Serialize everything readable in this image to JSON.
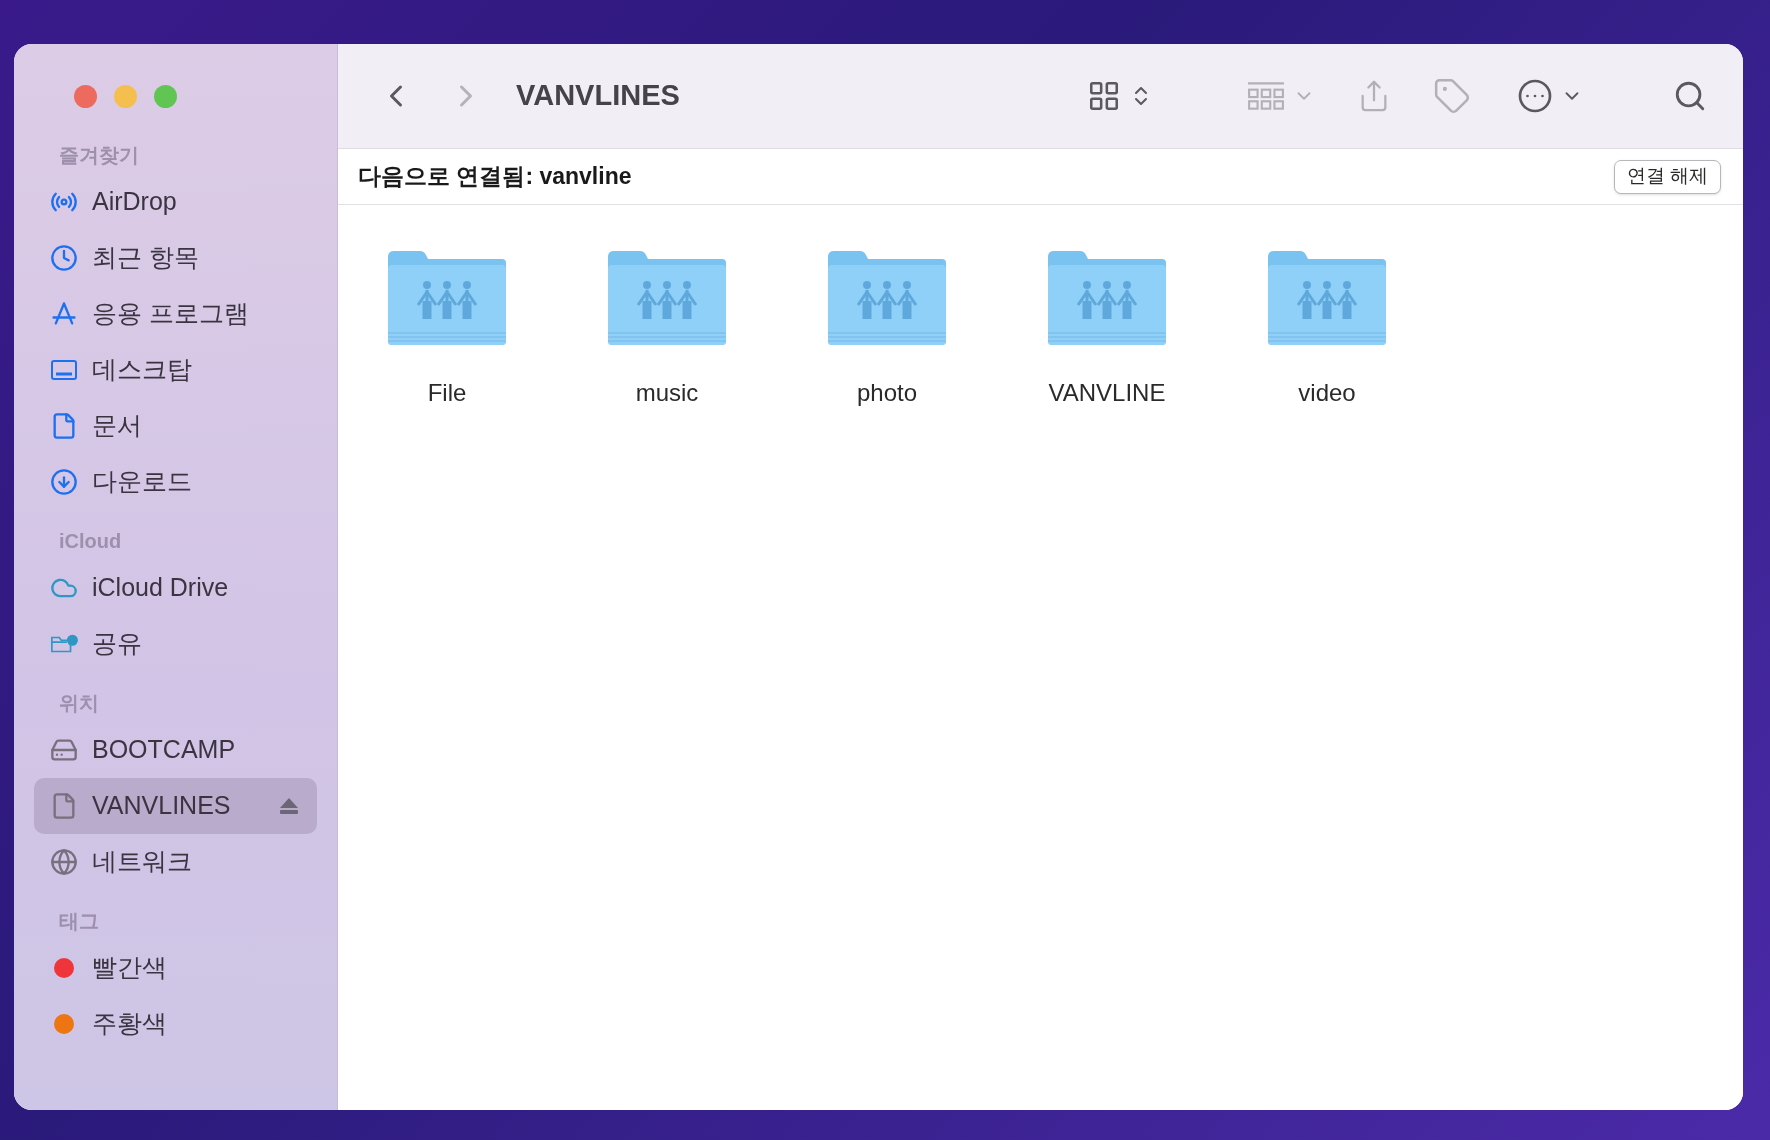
{
  "window": {
    "title": "VANVLINES"
  },
  "toolbar": {
    "back": {
      "disabled": false
    },
    "forward": {
      "disabled": true
    }
  },
  "sidebar": {
    "sections": [
      {
        "heading": "즐겨찾기",
        "items": [
          {
            "label": "AirDrop",
            "selected": false
          },
          {
            "label": "최근 항목",
            "selected": false
          },
          {
            "label": "응용 프로그램",
            "selected": false
          },
          {
            "label": "데스크탑",
            "selected": false
          },
          {
            "label": "문서",
            "selected": false
          },
          {
            "label": "다운로드",
            "selected": false
          }
        ]
      },
      {
        "heading": "iCloud",
        "items": [
          {
            "label": "iCloud Drive",
            "selected": false
          },
          {
            "label": "공유",
            "selected": false
          }
        ]
      },
      {
        "heading": "위치",
        "items": [
          {
            "label": "BOOTCAMP",
            "selected": false,
            "ejectable": false
          },
          {
            "label": "VANVLINES",
            "selected": true,
            "ejectable": true
          },
          {
            "label": "네트워크",
            "selected": false,
            "ejectable": false
          }
        ]
      },
      {
        "heading": "태그",
        "items": [
          {
            "label": "빨간색",
            "selected": false,
            "color": "#f0353a"
          },
          {
            "label": "주황색",
            "selected": false,
            "color": "#ed7512"
          }
        ]
      }
    ]
  },
  "connection_bar": {
    "text": "다음으로 연결됨: vanvline",
    "button": "연결 해제"
  },
  "folders": [
    {
      "name": "File",
      "selected": false
    },
    {
      "name": "music",
      "selected": false
    },
    {
      "name": "photo",
      "selected": false
    },
    {
      "name": "VANVLINE",
      "selected": false
    },
    {
      "name": "video",
      "selected": false
    }
  ]
}
